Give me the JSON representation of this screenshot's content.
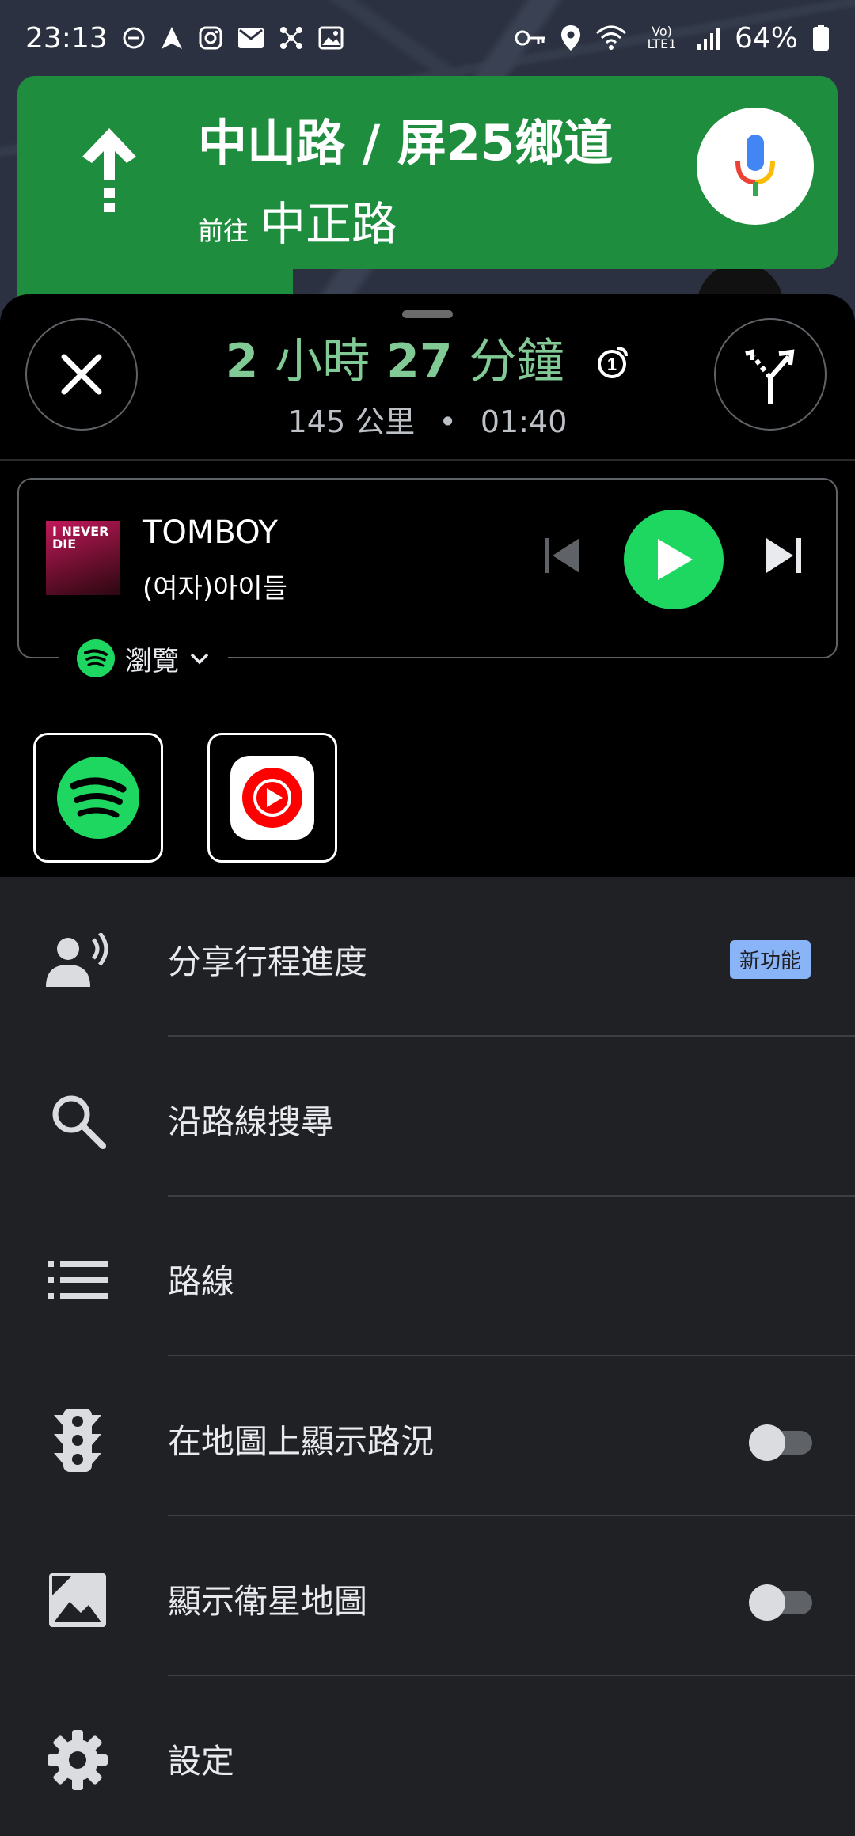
{
  "status_bar": {
    "time": "23:13",
    "signal_label": "Vo) LTE1",
    "battery": "64%"
  },
  "nav": {
    "street": "中山路 / 屏25鄉道",
    "toward_label": "前往",
    "toward_road": "中正路"
  },
  "trip": {
    "hours": "2",
    "hours_unit": "小時",
    "minutes": "27",
    "minutes_unit": "分鐘",
    "distance": "145 公里",
    "separator": "•",
    "arrival": "01:40"
  },
  "media": {
    "album_text": "I NEVER DIE",
    "title": "TOMBOY",
    "artist": "(여자)아이들",
    "source_label": "瀏覽"
  },
  "apps": [
    {
      "name": "Spotify",
      "icon": "spotify-icon"
    },
    {
      "name": "YouTube Music",
      "icon": "youtube-music-icon"
    }
  ],
  "menu": {
    "share": "分享行程進度",
    "new_badge": "新功能",
    "search_along": "沿路線搜尋",
    "route": "路線",
    "traffic": "在地圖上顯示路況",
    "satellite": "顯示衛星地圖",
    "settings": "設定"
  },
  "colors": {
    "nav_green": "#1e8e3e",
    "eta_green": "#81c995",
    "spotify_green": "#1ed760",
    "badge_blue": "#8ab4f8"
  }
}
